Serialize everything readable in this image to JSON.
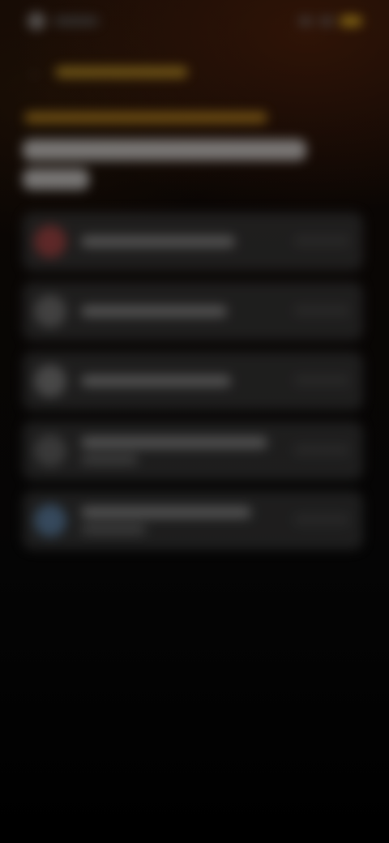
{
  "status_bar": {
    "time": "",
    "colors": {
      "battery": "#a8891a"
    }
  },
  "header": {
    "back_label": "",
    "eyebrow": "",
    "title": ""
  },
  "list": {
    "items": [
      {
        "title": "",
        "subtitle": "",
        "avatar_color": "#7a3434"
      },
      {
        "title": "",
        "subtitle": "",
        "avatar_color": "#555555"
      },
      {
        "title": "",
        "subtitle": "",
        "avatar_color": "#5e5e5e"
      },
      {
        "title": "",
        "subtitle": "",
        "avatar_color": "#4a4a4a"
      },
      {
        "title": "",
        "subtitle": "",
        "avatar_color": "#46607a"
      }
    ]
  },
  "colors": {
    "background": "#000000",
    "accent": "#8a6418",
    "card": "#262626"
  }
}
